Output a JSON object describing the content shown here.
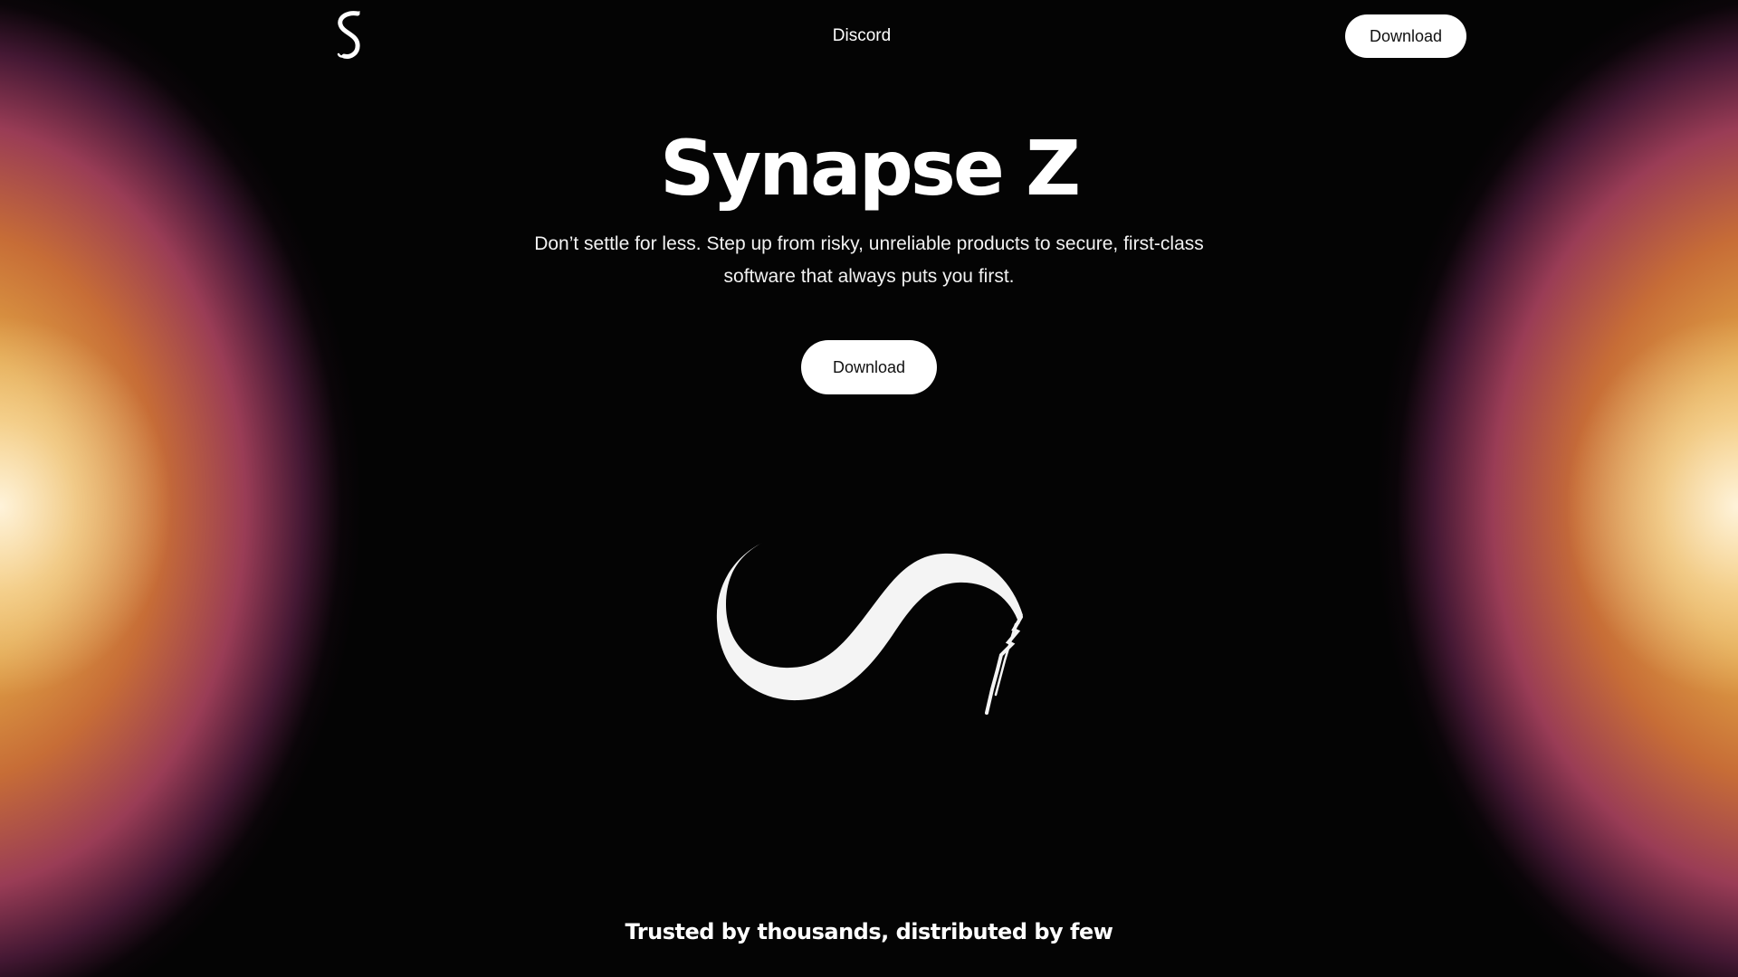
{
  "nav": {
    "logo_icon": "synapse-s-logo-icon",
    "discord_label": "Discord",
    "download_label": "Download"
  },
  "hero": {
    "title": "Synapse Z",
    "subtitle": "Don’t settle for less. Step up from risky, unreliable products to secure, first-class software that always puts you first.",
    "download_label": "Download",
    "emblem_icon": "synapse-brush-stroke-icon"
  },
  "trusted": {
    "heading": "Trusted by thousands, distributed by few"
  },
  "colors": {
    "background": "#040404",
    "button_bg": "#ffffff",
    "button_text": "#111111",
    "glow_gold": "#f8c45c",
    "glow_orange": "#dc783c",
    "glow_magenta": "#b44664"
  }
}
